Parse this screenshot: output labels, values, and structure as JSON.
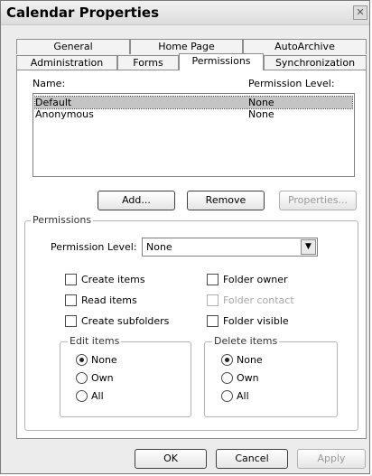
{
  "window": {
    "title": "Calendar Properties",
    "close_glyph": "✕"
  },
  "tabs_back": [
    {
      "label": "General"
    },
    {
      "label": "Home Page"
    },
    {
      "label": "AutoArchive"
    }
  ],
  "tabs_front": [
    {
      "label": "Administration"
    },
    {
      "label": "Forms"
    },
    {
      "label": "Permissions",
      "active": true
    },
    {
      "label": "Synchronization"
    }
  ],
  "list": {
    "name_header": "Name:",
    "level_header": "Permission Level:",
    "rows": [
      {
        "name": "Default",
        "level": "None",
        "selected": true
      },
      {
        "name": "Anonymous",
        "level": "None",
        "selected": false
      }
    ]
  },
  "list_buttons": {
    "add": "Add...",
    "remove": "Remove",
    "properties": "Properties..."
  },
  "permissions": {
    "group_label": "Permissions",
    "level_label": "Permission Level:",
    "level_value": "None",
    "checkboxes": {
      "create_items": "Create items",
      "read_items": "Read items",
      "create_subfolders": "Create subfolders",
      "folder_owner": "Folder owner",
      "folder_contact": "Folder contact",
      "folder_visible": "Folder visible"
    },
    "edit_items": {
      "label": "Edit items",
      "options": [
        "None",
        "Own",
        "All"
      ],
      "selected": "None"
    },
    "delete_items": {
      "label": "Delete items",
      "options": [
        "None",
        "Own",
        "All"
      ],
      "selected": "None"
    }
  },
  "footer": {
    "ok": "OK",
    "cancel": "Cancel",
    "apply": "Apply"
  }
}
